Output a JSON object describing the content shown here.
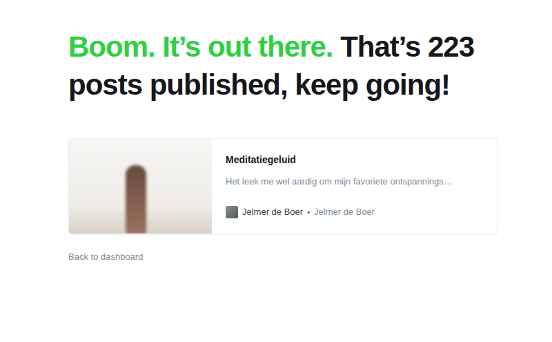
{
  "headline": {
    "highlight": "Boom. It’s out there.",
    "text": "That’s 223 posts published, keep going!"
  },
  "post": {
    "title": "Meditatiegeluid",
    "excerpt": "Het leek me wel aardig om mijn favoriete ontspannings…",
    "author": "Jelmer de Boer",
    "separator": "•",
    "byline": "Jelmer de Boer"
  },
  "back_link": "Back to dashboard"
}
